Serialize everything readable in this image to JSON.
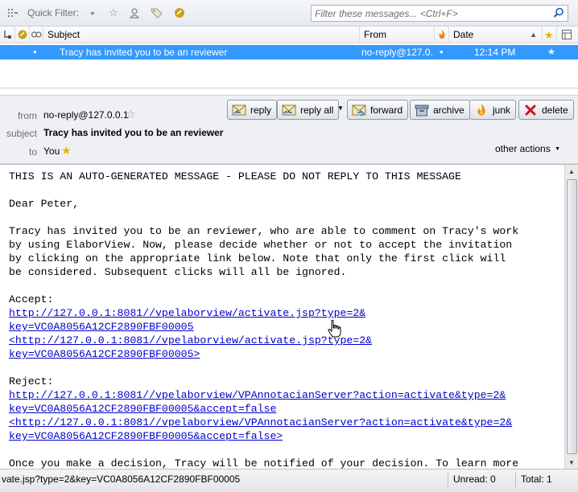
{
  "quick_filter": {
    "label": "Quick Filter:",
    "search_placeholder": "Filter these messages... <Ctrl+F>"
  },
  "thread_columns": {
    "subject": "Subject",
    "from": "From",
    "date": "Date"
  },
  "thread_rows": [
    {
      "subject": "Tracy has invited you to be an reviewer",
      "from": "no-reply@127.0....",
      "date": "12:14 PM",
      "selected": true
    }
  ],
  "message_header": {
    "from_label": "from",
    "from_value": "no-reply@127.0.0.1",
    "subject_label": "subject",
    "subject_value": "Tracy has invited you to be an reviewer",
    "to_label": "to",
    "to_value": "You",
    "other_actions": "other actions"
  },
  "toolbar": {
    "reply": "reply",
    "reply_all": "reply all",
    "forward": "forward",
    "archive": "archive",
    "junk": "junk",
    "delete": "delete"
  },
  "body": {
    "auto_line": "THIS IS AN AUTO-GENERATED MESSAGE - PLEASE DO NOT REPLY TO THIS MESSAGE",
    "greeting": "Dear Peter,",
    "para": "Tracy has invited you to be an reviewer, who are able to comment on Tracy's work\nby using ElaborView. Now, please decide whether or not to accept the invitation\nby clicking on the appropriate link below. Note that only the first click will\nbe considered. Subsequent clicks will all be ignored.",
    "accept_label": "Accept:",
    "accept_link_1a": "http://127.0.0.1:8081//vpelaborview/activate.jsp?type=2&",
    "accept_link_1b": "key=VC0A8056A12CF2890FBF00005",
    "accept_link_2a": "<http://127.0.0.1:8081//vpelaborview/activate.jsp?type=2&",
    "accept_link_2b": "key=VC0A8056A12CF2890FBF00005>",
    "reject_label": "Reject:",
    "reject_link_1a": "http://127.0.0.1:8081//vpelaborview/VPAnnotacianServer?action=activate&type=2&",
    "reject_link_1b": "key=VC0A8056A12CF2890FBF00005&accept=false",
    "reject_link_2a": "<http://127.0.0.1:8081//vpelaborview/VPAnnotacianServer?action=activate&type=2&",
    "reject_link_2b": "key=VC0A8056A12CF2890FBF00005&accept=false>",
    "final_line": "Once you make a decision, Tracy will be notified of your decision. To learn more"
  },
  "status_bar": {
    "url": "vate.jsp?type=2&key=VC0A8056A12CF2890FBF00005",
    "unread": "Unread: 0",
    "total": "Total: 1"
  },
  "colors": {
    "selection": "#3399ff",
    "link": "#0000cc"
  }
}
